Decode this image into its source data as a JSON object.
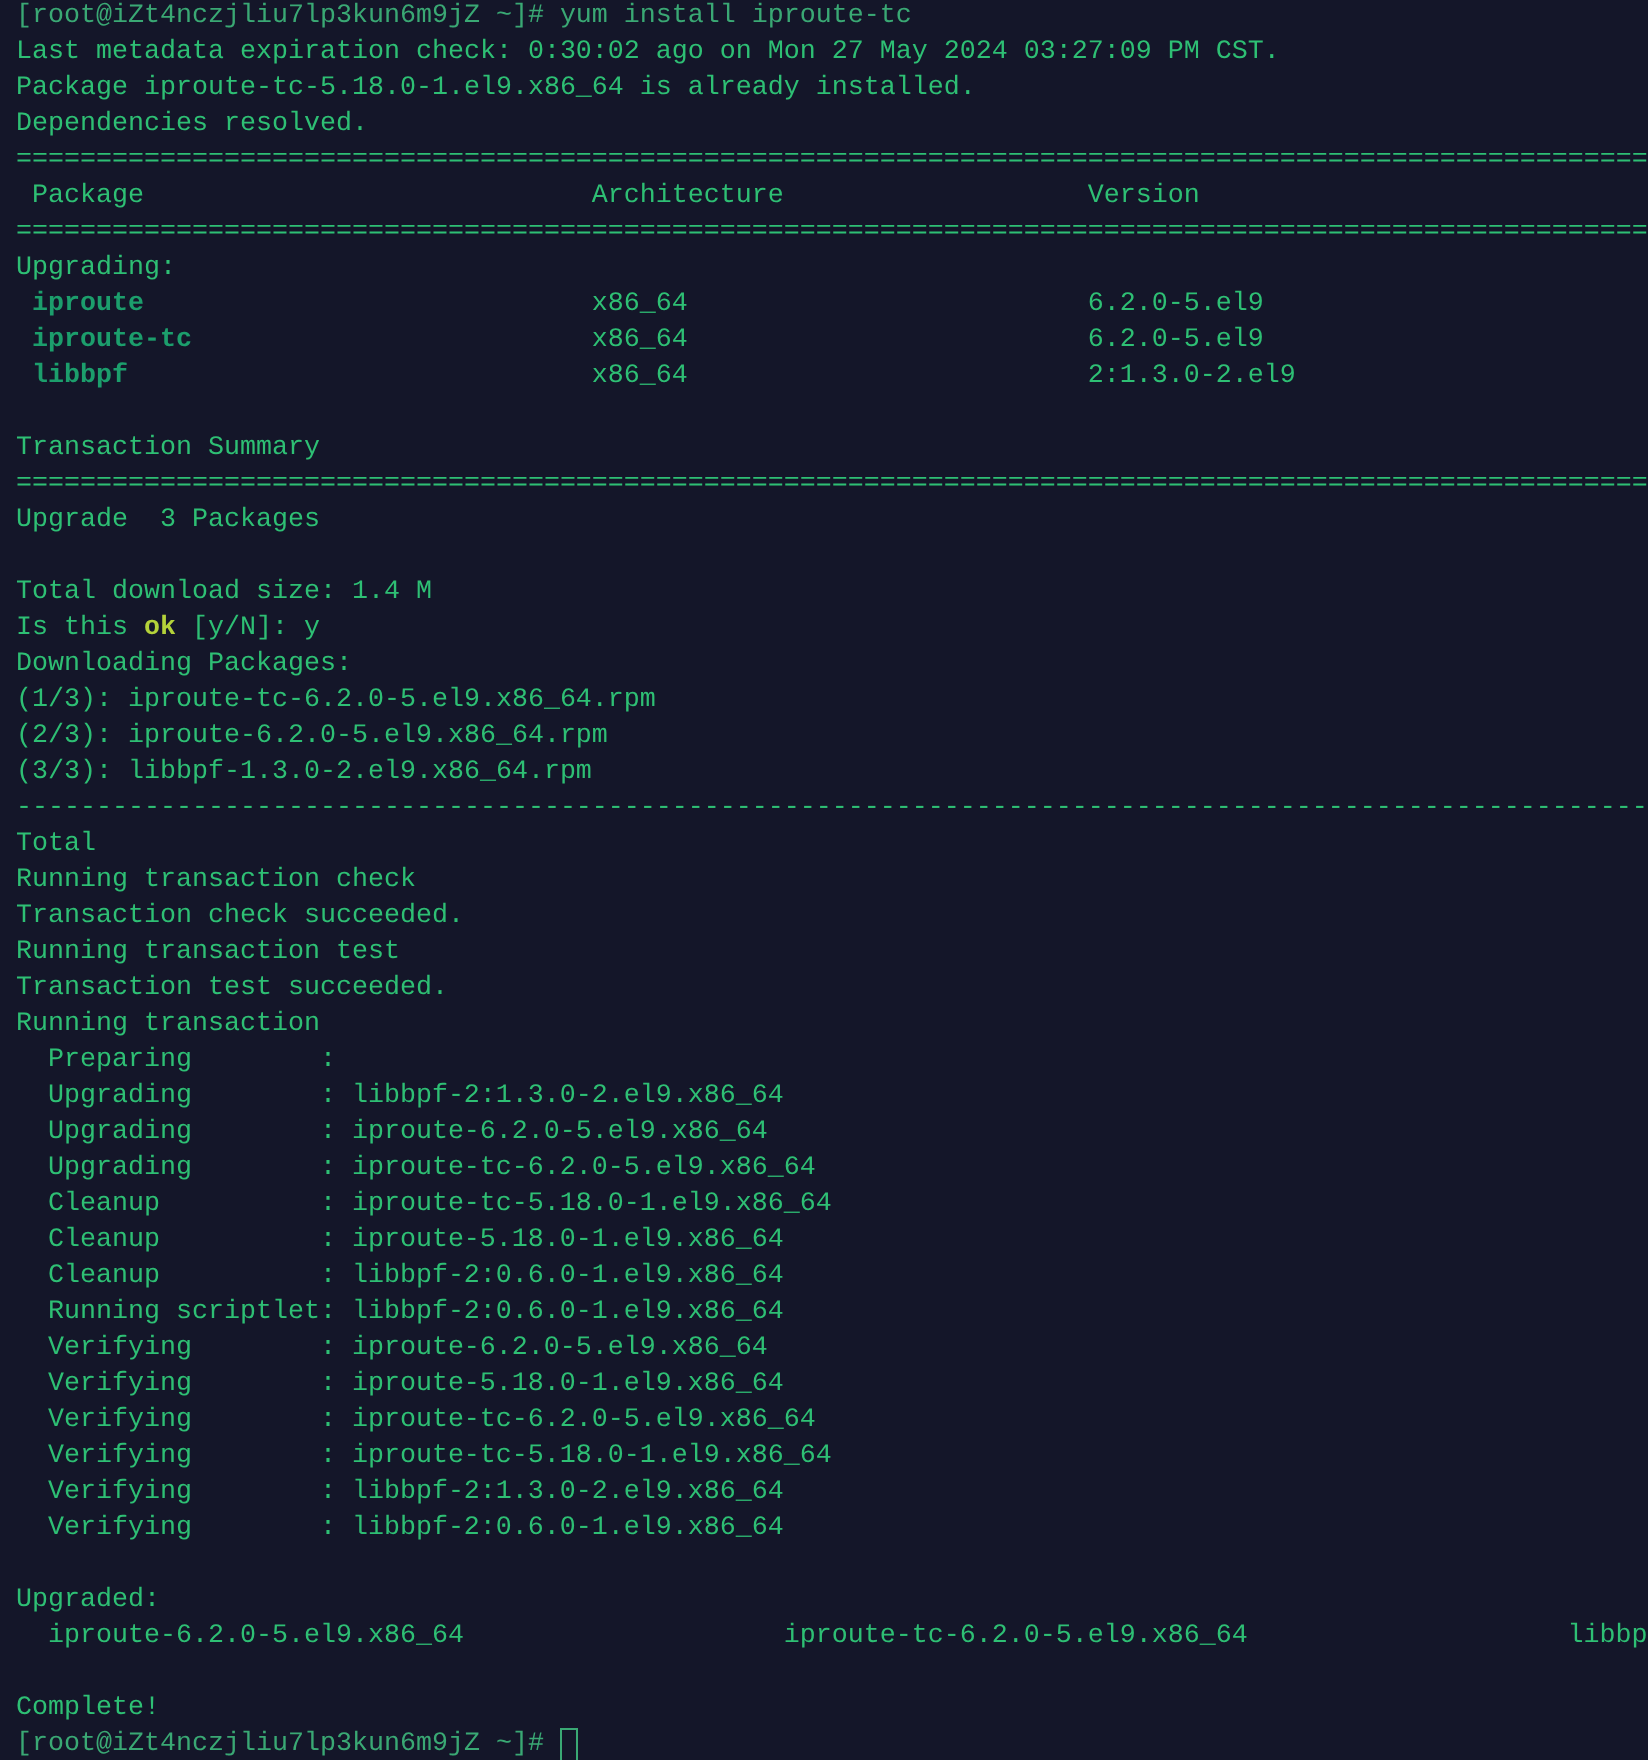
{
  "terminal": {
    "lines": [
      {
        "kind": "prompt",
        "text": "[root@iZt4nczjliu7lp3kun6m9jZ ~]# yum install iproute-tc",
        "cursor": false
      },
      {
        "kind": "text",
        "text": "Last metadata expiration check: 0:30:02 ago on Mon 27 May 2024 03:27:09 PM CST."
      },
      {
        "kind": "text",
        "text": "Package iproute-tc-5.18.0-1.el9.x86_64 is already installed."
      },
      {
        "kind": "text",
        "text": "Dependencies resolved."
      },
      {
        "kind": "rule",
        "text": "======================================================================================================"
      },
      {
        "kind": "table_row",
        "bold": false,
        "cells": [
          "Package",
          "Architecture",
          "Version"
        ]
      },
      {
        "kind": "rule",
        "text": "======================================================================================================"
      },
      {
        "kind": "text",
        "text": "Upgrading:"
      },
      {
        "kind": "table_row",
        "bold": true,
        "cells": [
          "iproute",
          "x86_64",
          "6.2.0-5.el9"
        ]
      },
      {
        "kind": "table_row",
        "bold": true,
        "cells": [
          "iproute-tc",
          "x86_64",
          "6.2.0-5.el9"
        ]
      },
      {
        "kind": "table_row",
        "bold": true,
        "cells": [
          "libbpf",
          "x86_64",
          "2:1.3.0-2.el9"
        ]
      },
      {
        "kind": "blank"
      },
      {
        "kind": "text",
        "text": "Transaction Summary"
      },
      {
        "kind": "rule",
        "text": "======================================================================================================"
      },
      {
        "kind": "text",
        "text": "Upgrade  3 Packages"
      },
      {
        "kind": "blank"
      },
      {
        "kind": "text",
        "text": "Total download size: 1.4 M"
      },
      {
        "kind": "text",
        "text": "Is this **ok** [y/N]: y"
      },
      {
        "kind": "text",
        "text": "Downloading Packages:"
      },
      {
        "kind": "text",
        "text": "(1/3): iproute-tc-6.2.0-5.el9.x86_64.rpm"
      },
      {
        "kind": "text",
        "text": "(2/3): iproute-6.2.0-5.el9.x86_64.rpm"
      },
      {
        "kind": "text",
        "text": "(3/3): libbpf-1.3.0-2.el9.x86_64.rpm"
      },
      {
        "kind": "rule",
        "text": "------------------------------------------------------------------------------------------------------"
      },
      {
        "kind": "text",
        "text": "Total"
      },
      {
        "kind": "text",
        "text": "Running transaction check"
      },
      {
        "kind": "text",
        "text": "Transaction check succeeded."
      },
      {
        "kind": "text",
        "text": "Running transaction test"
      },
      {
        "kind": "text",
        "text": "Transaction test succeeded."
      },
      {
        "kind": "text",
        "text": "Running transaction"
      },
      {
        "kind": "step",
        "cells": [
          "Preparing",
          ":"
        ]
      },
      {
        "kind": "step",
        "cells": [
          "Upgrading",
          ": libbpf-2:1.3.0-2.el9.x86_64"
        ]
      },
      {
        "kind": "step",
        "cells": [
          "Upgrading",
          ": iproute-6.2.0-5.el9.x86_64"
        ]
      },
      {
        "kind": "step",
        "cells": [
          "Upgrading",
          ": iproute-tc-6.2.0-5.el9.x86_64"
        ]
      },
      {
        "kind": "step",
        "cells": [
          "Cleanup",
          ": iproute-tc-5.18.0-1.el9.x86_64"
        ]
      },
      {
        "kind": "step",
        "cells": [
          "Cleanup",
          ": iproute-5.18.0-1.el9.x86_64"
        ]
      },
      {
        "kind": "step",
        "cells": [
          "Cleanup",
          ": libbpf-2:0.6.0-1.el9.x86_64"
        ]
      },
      {
        "kind": "step",
        "cells": [
          "Running scriptlet",
          ": libbpf-2:0.6.0-1.el9.x86_64"
        ]
      },
      {
        "kind": "step",
        "cells": [
          "Verifying",
          ": iproute-6.2.0-5.el9.x86_64"
        ]
      },
      {
        "kind": "step",
        "cells": [
          "Verifying",
          ": iproute-5.18.0-1.el9.x86_64"
        ]
      },
      {
        "kind": "step",
        "cells": [
          "Verifying",
          ": iproute-tc-6.2.0-5.el9.x86_64"
        ]
      },
      {
        "kind": "step",
        "cells": [
          "Verifying",
          ": iproute-tc-5.18.0-1.el9.x86_64"
        ]
      },
      {
        "kind": "step",
        "cells": [
          "Verifying",
          ": libbpf-2:1.3.0-2.el9.x86_64"
        ]
      },
      {
        "kind": "step",
        "cells": [
          "Verifying",
          ": libbpf-2:0.6.0-1.el9.x86_64"
        ]
      },
      {
        "kind": "blank"
      },
      {
        "kind": "text",
        "text": "Upgraded:"
      },
      {
        "kind": "upgraded_row",
        "cells": [
          "iproute-6.2.0-5.el9.x86_64",
          "iproute-tc-6.2.0-5.el9.x86_64",
          "libbp"
        ]
      },
      {
        "kind": "blank"
      },
      {
        "kind": "text",
        "text": "Complete!"
      },
      {
        "kind": "prompt",
        "text": "[root@iZt4nczjliu7lp3kun6m9jZ ~]#",
        "cursor": true
      }
    ]
  }
}
